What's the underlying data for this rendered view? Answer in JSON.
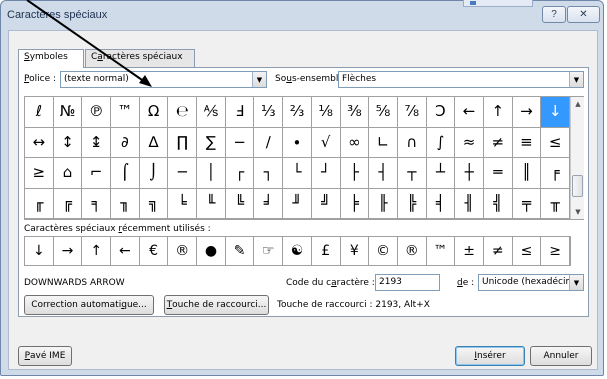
{
  "window": {
    "title": "Caractères spéciaux",
    "help_label": "?",
    "close_label": "✕"
  },
  "tabs": [
    {
      "label_u": "S",
      "label_rest": "ymboles",
      "active": true
    },
    {
      "label_pre": "C",
      "label_u": "a",
      "label_rest": "ractères spéciaux",
      "active": false
    }
  ],
  "font": {
    "label_u": "P",
    "label_rest": "olice :",
    "value": "(texte normal)"
  },
  "subset": {
    "label_pre": "So",
    "label_u": "u",
    "label_rest": "s-ensemble :",
    "value": "Flèches"
  },
  "symbol_grid": {
    "rows": [
      [
        "ℓ",
        "№",
        "℗",
        "™",
        "Ω",
        "℮",
        "⅍",
        "Ⅎ",
        "⅓",
        "⅔",
        "⅛",
        "⅜",
        "⅝",
        "⅞",
        "Ↄ",
        "←",
        "↑",
        "→",
        "↓"
      ],
      [
        "↔",
        "↕",
        "↨",
        "∂",
        "∆",
        "∏",
        "∑",
        "−",
        "∕",
        "∙",
        "√",
        "∞",
        "∟",
        "∩",
        "∫",
        "≈",
        "≠",
        "≡",
        "≤"
      ],
      [
        "≥",
        "⌂",
        "⌐",
        "⌠",
        "⌡",
        "─",
        "│",
        "┌",
        "┐",
        "└",
        "┘",
        "├",
        "┤",
        "┬",
        "┴",
        "┼",
        "═",
        "║",
        "╒"
      ],
      [
        "╓",
        "╔",
        "╕",
        "╖",
        "╗",
        "╘",
        "╙",
        "╚",
        "╛",
        "╜",
        "╝",
        "╞",
        "╟",
        "╠",
        "╡",
        "╢",
        "╣",
        "╤",
        "╥"
      ]
    ],
    "selected": "↓"
  },
  "recent": {
    "label_pre": "Caractères spéciaux ",
    "label_u": "r",
    "label_rest": "écemment utilisés :",
    "symbols": [
      "↓",
      "→",
      "↑",
      "←",
      "€",
      "®",
      "●",
      "✎",
      "☞",
      "☯",
      "£",
      "¥",
      "©",
      "®",
      "™",
      "±",
      "≠",
      "≤",
      "≥"
    ]
  },
  "char_name": "DOWNWARDS ARROW",
  "char_code": {
    "label_pre": "Code du c",
    "label_u": "a",
    "label_rest": "ractère :",
    "value": "2193"
  },
  "from": {
    "label_u": "d",
    "label_rest": "e :",
    "value": "Unicode (hexadécimal)"
  },
  "buttons": {
    "autocorrect": {
      "label_pre": "Correction automati",
      "label_u": "q",
      "label_rest": "ue..."
    },
    "shortcut": {
      "label_u": "T",
      "label_rest": "ouche de raccourci..."
    },
    "ime": {
      "label_u": "P",
      "label_rest": "avé IME"
    },
    "insert": {
      "label_u": "I",
      "label_rest": "nsérer"
    },
    "cancel": "Annuler"
  },
  "shortcut_info": "Touche de raccourci : 2193, Alt+X",
  "colors": {
    "selection": "#3399ff",
    "annotation_arrow": "#000000"
  }
}
